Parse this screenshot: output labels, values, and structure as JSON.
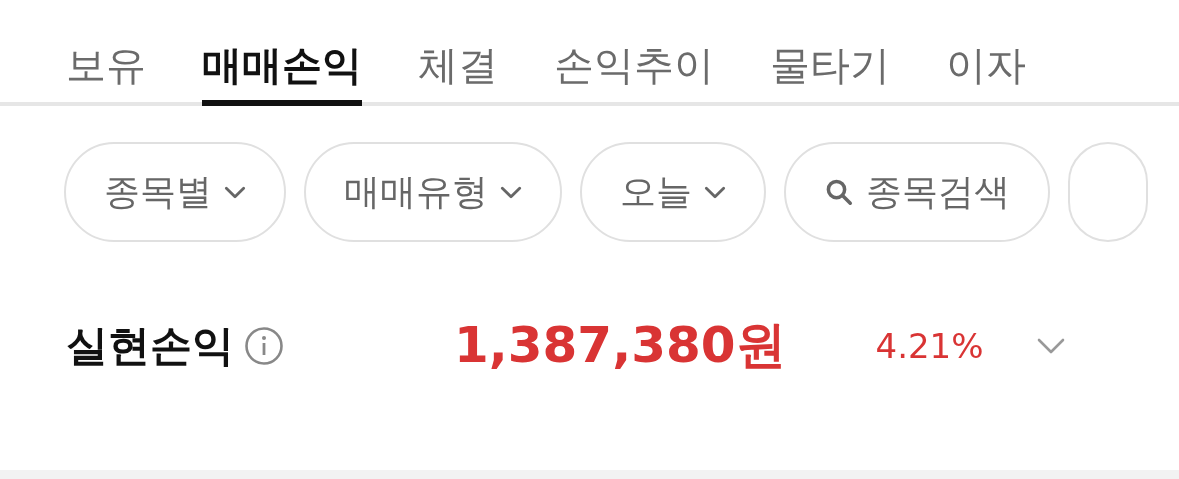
{
  "tabs": [
    {
      "label": "보유",
      "selected": false
    },
    {
      "label": "매매손익",
      "selected": true
    },
    {
      "label": "체결",
      "selected": false
    },
    {
      "label": "손익추이",
      "selected": false
    },
    {
      "label": "물타기",
      "selected": false
    },
    {
      "label": "이자",
      "selected": false
    }
  ],
  "filters": [
    {
      "kind": "dropdown",
      "label": "종목별"
    },
    {
      "kind": "dropdown",
      "label": "매매유형"
    },
    {
      "kind": "dropdown",
      "label": "오늘"
    },
    {
      "kind": "search",
      "label": "종목검색"
    }
  ],
  "summary": {
    "label": "실현손익",
    "amount": "1,387,380원",
    "rate": "4.21%",
    "expanded": false
  }
}
